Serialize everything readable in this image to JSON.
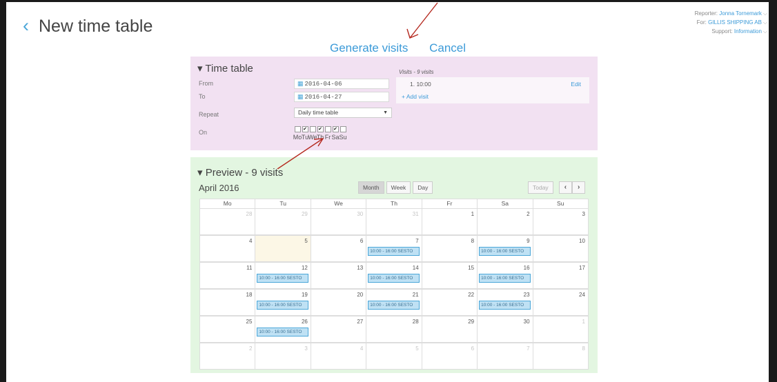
{
  "header": {
    "back_glyph": "‹",
    "title": "New time table"
  },
  "account": {
    "reporter_label": "Reporter:",
    "reporter_value": "Jonna Tornemark",
    "for_label": "For:",
    "for_value": "GILLIS SHIPPING AB",
    "support_label": "Support:",
    "support_value": "Information"
  },
  "actions": {
    "generate": "Generate visits",
    "cancel": "Cancel"
  },
  "timetable": {
    "heading": "▾ Time table",
    "from_label": "From",
    "from_value": "2016-04-06",
    "to_label": "To",
    "to_value": "2016-04-27",
    "repeat_label": "Repeat",
    "repeat_value": "Daily time table",
    "on_label": "On",
    "days": [
      {
        "label": "Mo",
        "checked": false
      },
      {
        "label": "Tu",
        "checked": true
      },
      {
        "label": "We",
        "checked": false
      },
      {
        "label": "Th",
        "checked": true
      },
      {
        "label": "Fr",
        "checked": false
      },
      {
        "label": "Sa",
        "checked": true
      },
      {
        "label": "Su",
        "checked": false
      }
    ],
    "visits_title": "Visits - 9 visits",
    "visit_1": "1. 10:00",
    "edit_label": "Edit",
    "add_visit_label": "+ Add visit"
  },
  "preview": {
    "heading": "▾ Preview - 9 visits",
    "month": "April 2016",
    "view_buttons": [
      "Month",
      "Week",
      "Day"
    ],
    "today_label": "Today",
    "prev_glyph": "‹",
    "next_glyph": "›",
    "weekdays": [
      "Mo",
      "Tu",
      "We",
      "Th",
      "Fr",
      "Sa",
      "Su"
    ],
    "event_label": "10:00 - 16:00 SESTO",
    "weeks": [
      [
        {
          "d": "28",
          "o": true
        },
        {
          "d": "29",
          "o": true
        },
        {
          "d": "30",
          "o": true
        },
        {
          "d": "31",
          "o": true
        },
        {
          "d": "1"
        },
        {
          "d": "2"
        },
        {
          "d": "3"
        }
      ],
      [
        {
          "d": "4"
        },
        {
          "d": "5",
          "today": true
        },
        {
          "d": "6"
        },
        {
          "d": "7",
          "ev": true
        },
        {
          "d": "8"
        },
        {
          "d": "9",
          "ev": true
        },
        {
          "d": "10"
        }
      ],
      [
        {
          "d": "11"
        },
        {
          "d": "12",
          "ev": true
        },
        {
          "d": "13"
        },
        {
          "d": "14",
          "ev": true
        },
        {
          "d": "15"
        },
        {
          "d": "16",
          "ev": true
        },
        {
          "d": "17"
        }
      ],
      [
        {
          "d": "18"
        },
        {
          "d": "19",
          "ev": true
        },
        {
          "d": "20"
        },
        {
          "d": "21",
          "ev": true
        },
        {
          "d": "22"
        },
        {
          "d": "23",
          "ev": true
        },
        {
          "d": "24"
        }
      ],
      [
        {
          "d": "25"
        },
        {
          "d": "26",
          "ev": true
        },
        {
          "d": "27"
        },
        {
          "d": "28"
        },
        {
          "d": "29"
        },
        {
          "d": "30"
        },
        {
          "d": "1",
          "o": true
        }
      ],
      [
        {
          "d": "2",
          "o": true
        },
        {
          "d": "3",
          "o": true
        },
        {
          "d": "4",
          "o": true
        },
        {
          "d": "5",
          "o": true
        },
        {
          "d": "6",
          "o": true
        },
        {
          "d": "7",
          "o": true
        },
        {
          "d": "8",
          "o": true
        }
      ]
    ]
  },
  "colors": {
    "accent": "#3b9ad8",
    "timetable_bg": "#f2e1f2",
    "preview_bg": "#e3f6e1",
    "annotation": "#b5291f"
  }
}
